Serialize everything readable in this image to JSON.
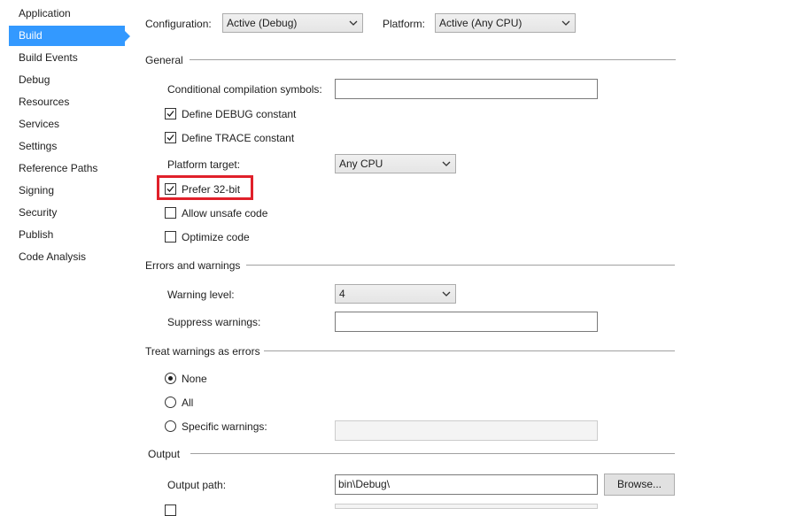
{
  "sidebar": {
    "items": [
      {
        "label": "Application"
      },
      {
        "label": "Build",
        "selected": true
      },
      {
        "label": "Build Events"
      },
      {
        "label": "Debug"
      },
      {
        "label": "Resources"
      },
      {
        "label": "Services"
      },
      {
        "label": "Settings"
      },
      {
        "label": "Reference Paths"
      },
      {
        "label": "Signing"
      },
      {
        "label": "Security"
      },
      {
        "label": "Publish"
      },
      {
        "label": "Code Analysis"
      }
    ]
  },
  "header": {
    "configuration_label": "Configuration:",
    "configuration_value": "Active (Debug)",
    "platform_label": "Platform:",
    "platform_value": "Active (Any CPU)"
  },
  "general": {
    "title": "General",
    "conditional_symbols_label": "Conditional compilation symbols:",
    "conditional_symbols_value": "",
    "define_debug_label": "Define DEBUG constant",
    "define_debug_checked": true,
    "define_trace_label": "Define TRACE constant",
    "define_trace_checked": true,
    "platform_target_label": "Platform target:",
    "platform_target_value": "Any CPU",
    "prefer32_label": "Prefer 32-bit",
    "prefer32_checked": true,
    "allow_unsafe_label": "Allow unsafe code",
    "allow_unsafe_checked": false,
    "optimize_label": "Optimize code",
    "optimize_checked": false
  },
  "errors": {
    "title": "Errors and warnings",
    "warning_level_label": "Warning level:",
    "warning_level_value": "4",
    "suppress_label": "Suppress warnings:",
    "suppress_value": ""
  },
  "treat": {
    "title": "Treat warnings as errors",
    "none_label": "None",
    "all_label": "All",
    "specific_label": "Specific warnings:",
    "selected": "None",
    "specific_value": ""
  },
  "output": {
    "title": "Output",
    "path_label": "Output path:",
    "path_value": "bin\\Debug\\",
    "browse_label": "Browse..."
  },
  "colors": {
    "selection": "#3399ff",
    "highlight_box": "#e0202a"
  }
}
